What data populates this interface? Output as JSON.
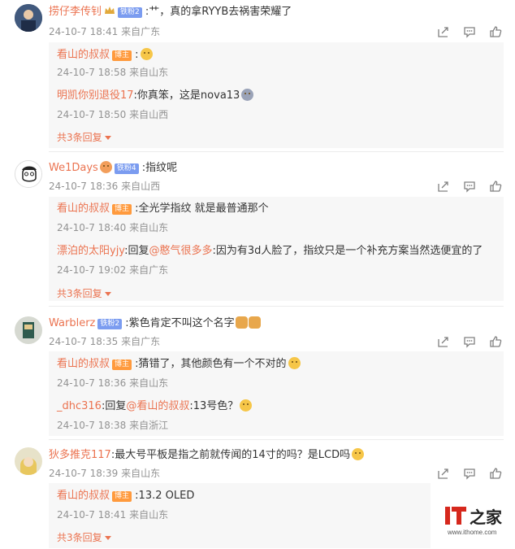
{
  "colors": {
    "username": "#eb7350",
    "meta": "#939393",
    "reply_bg": "#f7f7f7",
    "fan_badge": "#7b9cf0",
    "owner_badge": "#ff9a3d"
  },
  "icons": [
    "share-icon",
    "comment-icon",
    "like-icon"
  ],
  "comments": [
    {
      "user": "捞仔李传钊",
      "badge": "铁粉2",
      "text": ":艹，真的拿RYYB去祸害荣耀了",
      "time": "24-10-7 18:41",
      "location": "来自广东",
      "replies": [
        {
          "user": "看山的叔叔",
          "badge": "博主",
          "text": ":",
          "time": "24-10-7 18:58",
          "location": "来自山东"
        },
        {
          "user": "明凯你别退役17",
          "text": ":你真笨，这是nova13",
          "time": "24-10-7 18:50",
          "location": "来自山西"
        }
      ],
      "more": "共3条回复"
    },
    {
      "user": "We1Days",
      "badge": "铁粉4",
      "text": ":指纹呢",
      "time": "24-10-7 18:36",
      "location": "来自山西",
      "replies": [
        {
          "user": "看山的叔叔",
          "badge": "博主",
          "text": ":全光学指纹 就是最普通那个",
          "time": "24-10-7 18:40",
          "location": "来自山东"
        },
        {
          "user": "漂泊的太阳yjy",
          "text_prefix": ":回复",
          "mention": "@憨气很多多",
          "text": ":因为有3d人脸了，指纹只是一个补充方案当然选便宜的了",
          "time": "24-10-7 19:02",
          "location": "来自广东"
        }
      ],
      "more": "共3条回复"
    },
    {
      "user": "Warblerz",
      "badge": "铁粉2",
      "text": ":紫色肯定不叫这个名字",
      "time": "24-10-7 18:35",
      "location": "来自广东",
      "replies": [
        {
          "user": "看山的叔叔",
          "badge": "博主",
          "text": ":猜错了，其他颜色有一个不对的",
          "time": "24-10-7 18:36",
          "location": "来自山东"
        },
        {
          "user": "_dhc316",
          "text_prefix": ":回复",
          "mention": "@看山的叔叔",
          "text": ":13号色？",
          "time": "24-10-7 18:38",
          "location": "来自浙江"
        }
      ]
    },
    {
      "user": "狄多推克117",
      "text": ":最大号平板是指之前就传闻的14寸的吗？是LCD吗",
      "time": "24-10-7 18:39",
      "location": "来自山东",
      "replies": [
        {
          "user": "看山的叔叔",
          "badge": "博主",
          "text": ":13.2 OLED",
          "time": "24-10-7 18:41",
          "location": "来自山东"
        }
      ],
      "more": "共3条回复"
    }
  ],
  "watermark": {
    "brand": "IT之家",
    "url": "www.ithome.com"
  }
}
